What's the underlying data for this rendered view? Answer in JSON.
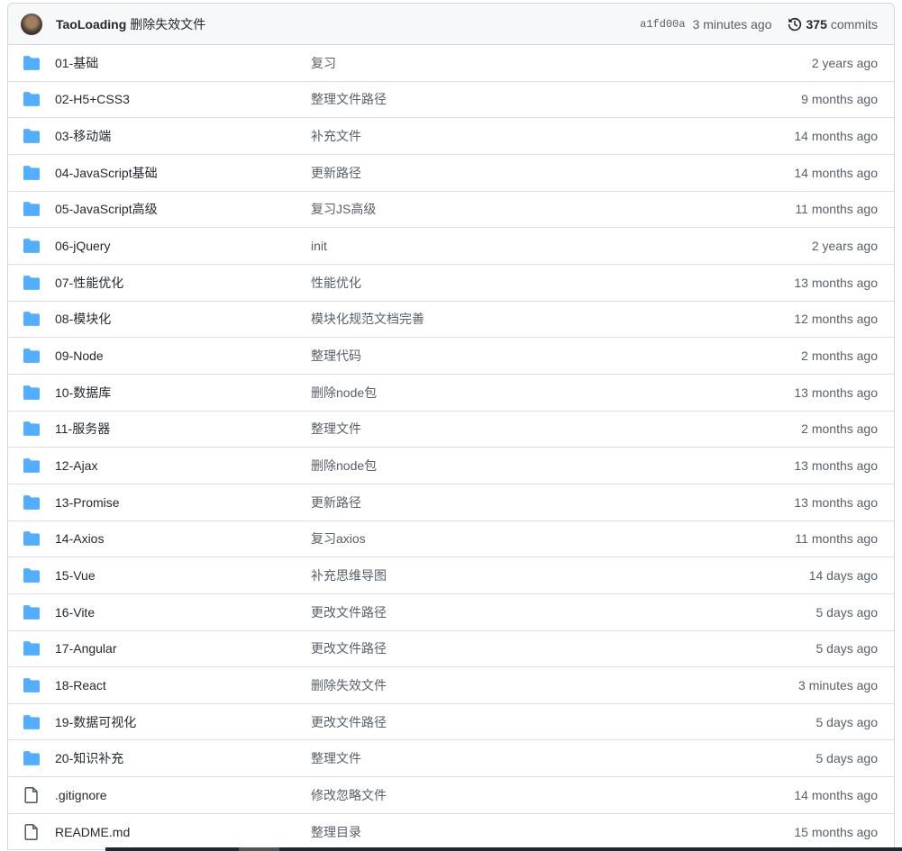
{
  "commit": {
    "author": "TaoLoading",
    "message": "删除失效文件",
    "sha": "a1fd00a",
    "time": "3 minutes ago",
    "count": "375",
    "count_label": "commits"
  },
  "files": [
    {
      "type": "dir",
      "name": "01-基础",
      "message": "复习",
      "time": "2 years ago"
    },
    {
      "type": "dir",
      "name": "02-H5+CSS3",
      "message": "整理文件路径",
      "time": "9 months ago"
    },
    {
      "type": "dir",
      "name": "03-移动端",
      "message": "补充文件",
      "time": "14 months ago"
    },
    {
      "type": "dir",
      "name": "04-JavaScript基础",
      "message": "更新路径",
      "time": "14 months ago"
    },
    {
      "type": "dir",
      "name": "05-JavaScript高级",
      "message": "复习JS高级",
      "time": "11 months ago"
    },
    {
      "type": "dir",
      "name": "06-jQuery",
      "message": "init",
      "time": "2 years ago"
    },
    {
      "type": "dir",
      "name": "07-性能优化",
      "message": "性能优化",
      "time": "13 months ago"
    },
    {
      "type": "dir",
      "name": "08-模块化",
      "message": "模块化规范文档完善",
      "time": "12 months ago"
    },
    {
      "type": "dir",
      "name": "09-Node",
      "message": "整理代码",
      "time": "2 months ago"
    },
    {
      "type": "dir",
      "name": "10-数据库",
      "message": "删除node包",
      "time": "13 months ago"
    },
    {
      "type": "dir",
      "name": "11-服务器",
      "message": "整理文件",
      "time": "2 months ago"
    },
    {
      "type": "dir",
      "name": "12-Ajax",
      "message": "删除node包",
      "time": "13 months ago"
    },
    {
      "type": "dir",
      "name": "13-Promise",
      "message": "更新路径",
      "time": "13 months ago"
    },
    {
      "type": "dir",
      "name": "14-Axios",
      "message": "复习axios",
      "time": "11 months ago"
    },
    {
      "type": "dir",
      "name": "15-Vue",
      "message": "补充思维导图",
      "time": "14 days ago"
    },
    {
      "type": "dir",
      "name": "16-Vite",
      "message": "更改文件路径",
      "time": "5 days ago"
    },
    {
      "type": "dir",
      "name": "17-Angular",
      "message": "更改文件路径",
      "time": "5 days ago"
    },
    {
      "type": "dir",
      "name": "18-React",
      "message": "删除失效文件",
      "time": "3 minutes ago"
    },
    {
      "type": "dir",
      "name": "19-数据可视化",
      "message": "更改文件路径",
      "time": "5 days ago"
    },
    {
      "type": "dir",
      "name": "20-知识补充",
      "message": "整理文件",
      "time": "5 days ago"
    },
    {
      "type": "file",
      "name": ".gitignore",
      "message": "修改忽略文件",
      "time": "14 months ago"
    },
    {
      "type": "file",
      "name": "README.md",
      "message": "整理目录",
      "time": "15 months ago"
    }
  ],
  "colors": {
    "folder": "#54aeff",
    "file": "#57606a"
  }
}
